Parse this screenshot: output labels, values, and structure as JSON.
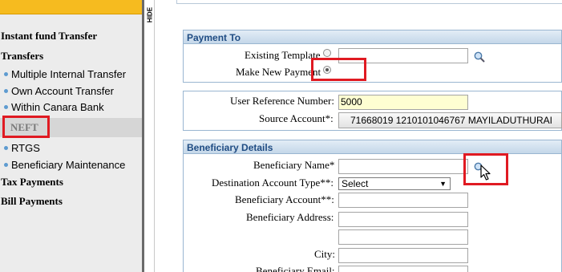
{
  "sidebar": {
    "headings": {
      "instant_fund_transfer": "Instant fund Transfer",
      "transfers": "Transfers",
      "tax_payments": "Tax Payments",
      "bill_payments": "Bill Payments"
    },
    "items": {
      "multiple_internal": "Multiple Internal Transfer",
      "own_account": "Own Account Transfer",
      "within_canara": "Within Canara Bank",
      "neft": "NEFT",
      "rtgs": "RTGS",
      "beneficiary_maintenance": "Beneficiary Maintenance"
    }
  },
  "hide_label": "HIDE",
  "payment_to": {
    "title": "Payment To",
    "existing_template_label": "Existing Template",
    "make_new_payment_label": "Make New Payment",
    "existing_template_value": "",
    "selected_option": "Make New Payment"
  },
  "reference": {
    "user_ref_label": "User Reference Number:",
    "user_ref_value": "5000",
    "source_account_label": "Source Account*:",
    "source_account_value": "71668019 1210101046767 MAYILADUTHURAI"
  },
  "beneficiary": {
    "title": "Beneficiary Details",
    "name_label": "Beneficiary Name*",
    "name_value": "",
    "dest_type_label": "Destination Account Type**:",
    "dest_type_value": "Select",
    "account_label": "Beneficiary Account**:",
    "account_value": "",
    "address_label": "Beneficiary Address:",
    "address_line1": "",
    "address_line2": "",
    "city_label": "City:",
    "city_value": "",
    "email_label": "Beneficiary Email:"
  },
  "colors": {
    "accent_yellow": "#f6bb1f",
    "panel_header_text": "#1f4c83",
    "highlight_red": "#e01a22"
  }
}
